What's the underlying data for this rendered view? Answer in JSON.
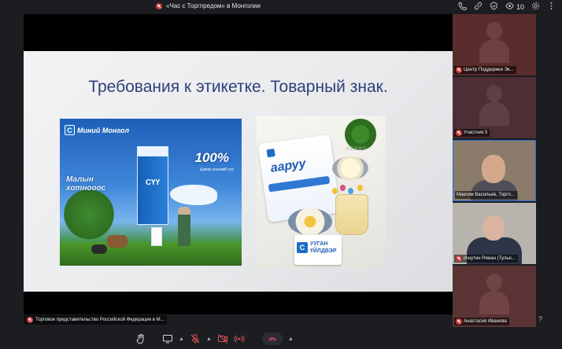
{
  "window": {
    "title": "«Час с Торгпредом» в Монголии",
    "participant_count": "10"
  },
  "slide": {
    "title": "Требования к этикетке. Товарный знак.",
    "left_image": {
      "brand": "Миний Монгол",
      "percent": "100%",
      "percent_caption": "Цэвэр үнээний сүү",
      "carton_label": "СҮҮ",
      "slogan_line1": "Малын",
      "slogan_line2": "хотнооос"
    },
    "right_image": {
      "bag_title": "ааруу",
      "herbs_word": "HERBS",
      "pack_line1": "УУГАН",
      "pack_line2": "ҮЙЛДВЭР"
    }
  },
  "participants": [
    {
      "name": "Центр Поддержки Эк...",
      "muted": true
    },
    {
      "name": "Участник 5",
      "muted": true
    },
    {
      "name": "Максим Васильев, Торгп...",
      "muted": false
    },
    {
      "name": "Ишутин Роман (Тулье...",
      "muted": true
    },
    {
      "name": "Анастасия Иванова",
      "muted": true
    }
  ],
  "presenter": {
    "name": "Торговое представительство Российской Федерации в М..."
  },
  "help_label": "?",
  "colors": {
    "background": "#1b1d21",
    "slide_title": "#2e3f7a",
    "muted_red": "#d33b3b",
    "active_border": "#2f6fd4"
  }
}
